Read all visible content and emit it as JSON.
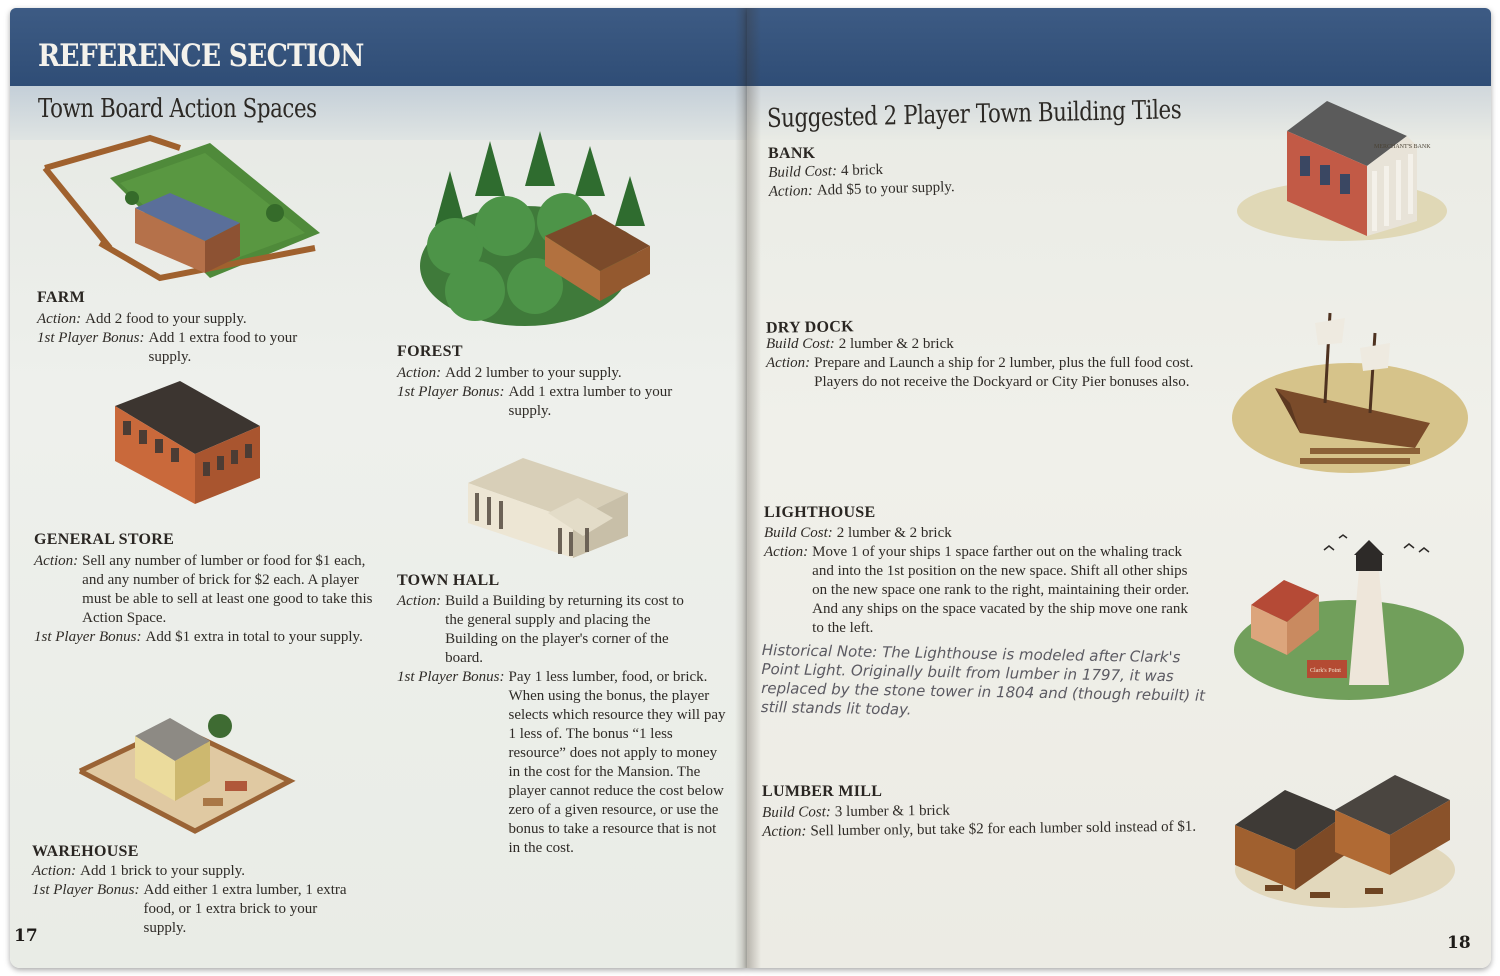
{
  "left_page": {
    "header": "REFERENCE SECTION",
    "section_title": "Town Board Action Spaces",
    "page_number": "17",
    "farm": {
      "title": "FARM",
      "action_label": "Action:",
      "action_text": "Add 2 food to your supply.",
      "bonus_label": "1st Player Bonus:",
      "bonus_text": "Add 1 extra food to your supply."
    },
    "forest": {
      "title": "FOREST",
      "action_label": "Action:",
      "action_text": "Add 2 lumber to your supply.",
      "bonus_label": "1st Player Bonus:",
      "bonus_text": "Add 1 extra lumber to your supply."
    },
    "general_store": {
      "title": "GENERAL STORE",
      "action_label": "Action:",
      "action_text": "Sell any number of lumber or food for $1 each, and any number of brick for $2 each. A player must be able to sell at least one good to take this Action Space.",
      "bonus_label": "1st Player Bonus:",
      "bonus_text": "Add $1 extra in total to your supply."
    },
    "town_hall": {
      "title": "TOWN HALL",
      "action_label": "Action:",
      "action_text": "Build a Building by returning its cost to the general supply and placing the Building on the player's corner of the board.",
      "bonus_label": "1st Player Bonus:",
      "bonus_text": "Pay 1 less lumber, food, or brick. When using the bonus, the player selects which resource they will pay 1 less of. The bonus “1 less resource” does not apply to money in the cost for the Mansion. The player cannot reduce the cost below zero of a given resource, or use the bonus to take a resource that is not in the cost."
    },
    "warehouse": {
      "title": "WAREHOUSE",
      "action_label": "Action:",
      "action_text": "Add 1 brick to your supply.",
      "bonus_label": "1st Player Bonus:",
      "bonus_text": "Add either 1 extra lumber, 1 extra food, or 1 extra brick to your supply."
    }
  },
  "right_page": {
    "section_title": "Suggested 2 Player Town Building Tiles",
    "page_number": "18",
    "bank": {
      "title": "BANK",
      "cost_label": "Build Cost:",
      "cost_text": "4 brick",
      "action_label": "Action:",
      "action_text": "Add $5 to your supply.",
      "sign_text": "MERCHANT'S BANK"
    },
    "dry_dock": {
      "title": "DRY DOCK",
      "cost_label": "Build Cost:",
      "cost_text": "2 lumber & 2 brick",
      "action_label": "Action:",
      "action_text": "Prepare and Launch a ship for 2 lumber, plus the full food cost. Players do not receive the Dockyard or City Pier bonuses also."
    },
    "lighthouse": {
      "title": "LIGHTHOUSE",
      "cost_label": "Build Cost:",
      "cost_text": "2 lumber & 2 brick",
      "action_label": "Action:",
      "action_text": "Move 1 of your ships 1 space farther out on the whaling track and into the 1st position on the new space. Shift all other ships on the new space one rank to the right, maintaining their order. And any ships on the space vacated by the ship move one rank to the left.",
      "historical_note": "Historical Note: The Lighthouse is modeled after Clark's Point Light. Originally built from lumber in 1797, it was replaced by the stone tower in 1804 and (though rebuilt) it still stands lit today.",
      "sign_text": "Clark's Point"
    },
    "lumber_mill": {
      "title": "LUMBER MILL",
      "cost_label": "Build Cost:",
      "cost_text": "3 lumber & 1 brick",
      "action_label": "Action:",
      "action_text": "Sell lumber only, but take $2 for each lumber sold instead of $1."
    }
  }
}
